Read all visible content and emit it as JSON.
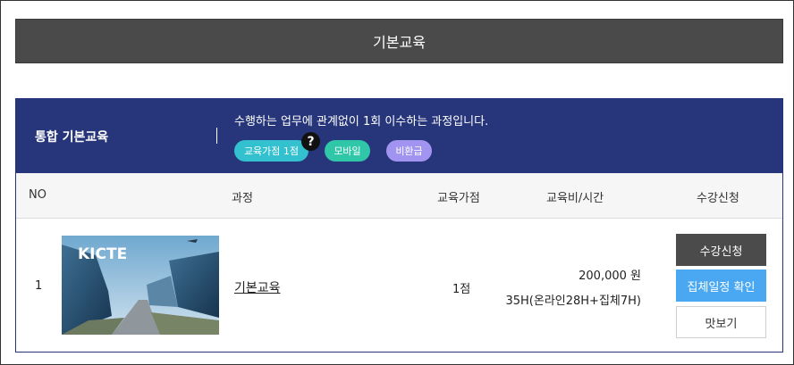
{
  "page_title": "기본교육",
  "course": {
    "category": "통합 기본교육",
    "description": "수행하는 업무에 관계없이 1회 이수하는 과정입니다.",
    "badges": [
      "교육가점 1점",
      "모바일",
      "비환급"
    ],
    "help_icon": "?"
  },
  "table": {
    "headers": [
      "NO",
      "과정",
      "교육가점",
      "교육비/시간",
      "수강신청"
    ],
    "rows": [
      {
        "no": "1",
        "thumbnail_text": "KICTE",
        "course_name": "기본교육",
        "points": "1점",
        "fee": "200,000 원",
        "hours": "35H(온라인28H+집체7H)",
        "buttons": [
          "수강신청",
          "집체일정 확인",
          "맛보기"
        ]
      }
    ]
  },
  "colors": {
    "title_bar": "#4a4a4a",
    "course_header": "#27367b",
    "badge_cyan": "#33c0cf",
    "badge_green": "#2fc7a8",
    "badge_purple": "#a193f0",
    "button_dark": "#4b4b4b",
    "button_blue": "#4aa8f2"
  }
}
